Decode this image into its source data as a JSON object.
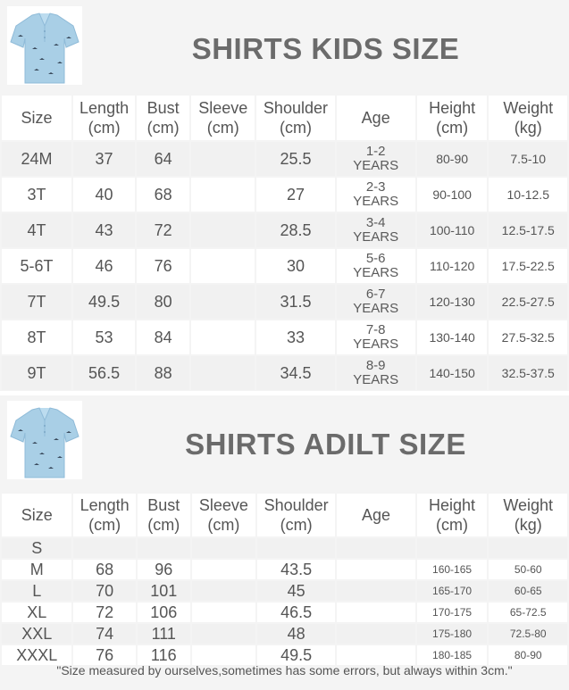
{
  "kids": {
    "title": "SHIRTS KIDS SIZE",
    "headers": [
      "Size",
      "Length\n(cm)",
      "Bust\n(cm)",
      "Sleeve\n(cm)",
      "Shoulder\n(cm)",
      "Age",
      "Height\n(cm)",
      "Weight\n(kg)"
    ],
    "rows": [
      [
        "24M",
        "37",
        "64",
        "",
        "25.5",
        "1-2\nYEARS",
        "80-90",
        "7.5-10"
      ],
      [
        "3T",
        "40",
        "68",
        "",
        "27",
        "2-3\nYEARS",
        "90-100",
        "10-12.5"
      ],
      [
        "4T",
        "43",
        "72",
        "",
        "28.5",
        "3-4\nYEARS",
        "100-110",
        "12.5-17.5"
      ],
      [
        "5-6T",
        "46",
        "76",
        "",
        "30",
        "5-6\nYEARS",
        "110-120",
        "17.5-22.5"
      ],
      [
        "7T",
        "49.5",
        "80",
        "",
        "31.5",
        "6-7\nYEARS",
        "120-130",
        "22.5-27.5"
      ],
      [
        "8T",
        "53",
        "84",
        "",
        "33",
        "7-8\nYEARS",
        "130-140",
        "27.5-32.5"
      ],
      [
        "9T",
        "56.5",
        "88",
        "",
        "34.5",
        "8-9\nYEARS",
        "140-150",
        "32.5-37.5"
      ]
    ]
  },
  "adult": {
    "title": "SHIRTS ADILT SIZE",
    "headers": [
      "Size",
      "Length\n(cm)",
      "Bust\n(cm)",
      "Sleeve\n(cm)",
      "Shoulder\n(cm)",
      "Age",
      "Height\n(cm)",
      "Weight\n(kg)"
    ],
    "rows": [
      [
        "S",
        "",
        "",
        "",
        "",
        "",
        "",
        ""
      ],
      [
        "M",
        "68",
        "96",
        "",
        "43.5",
        "",
        "160-165",
        "50-60"
      ],
      [
        "L",
        "70",
        "101",
        "",
        "45",
        "",
        "165-170",
        "60-65"
      ],
      [
        "XL",
        "72",
        "106",
        "",
        "46.5",
        "",
        "170-175",
        "65-72.5"
      ],
      [
        "XXL",
        "74",
        "111",
        "",
        "48",
        "",
        "175-180",
        "72.5-80"
      ],
      [
        "XXXL",
        "76",
        "116",
        "",
        "49.5",
        "",
        "180-185",
        "80-90"
      ]
    ],
    "note": "\"Size measured by ourselves,sometimes has some errors, but always within 3cm.\""
  },
  "colors": {
    "shirt": "#a9cfe6",
    "shirt_shadow": "#8fbbd8",
    "bird": "#3a4a5c",
    "title": "#6b6b6b"
  },
  "icons": [
    "shirt-product-image"
  ]
}
